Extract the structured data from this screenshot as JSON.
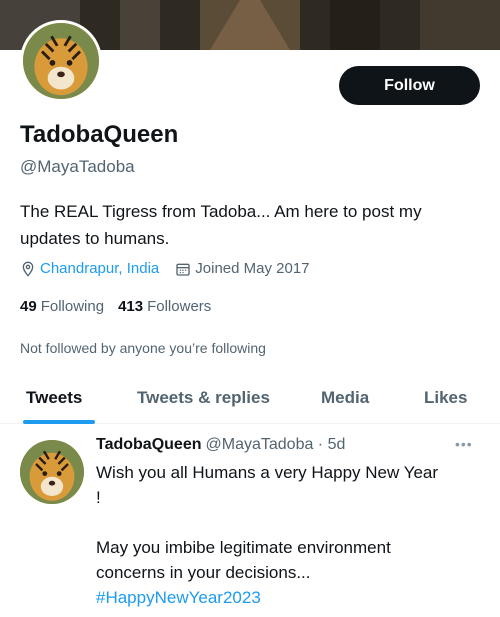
{
  "profile": {
    "display_name": "TadobaQueen",
    "handle": "@MayaTadoba",
    "bio": "The REAL Tigress from Tadoba... Am here to post my updates to humans.",
    "location": "Chandrapur, India",
    "joined": "Joined May 2017",
    "following_count": "49",
    "following_label": "Following",
    "followers_count": "413",
    "followers_label": "Followers",
    "not_followed_text": "Not followed by anyone you’re following",
    "follow_button": "Follow"
  },
  "tabs": [
    {
      "label": "Tweets",
      "active": true
    },
    {
      "label": "Tweets & replies",
      "active": false
    },
    {
      "label": "Media",
      "active": false
    },
    {
      "label": "Likes",
      "active": false
    }
  ],
  "tweet": {
    "name": "TadobaQueen",
    "handle_time": "@MayaTadoba · 5d",
    "line1": "Wish you all Humans a very Happy New Year",
    "line2": "!",
    "line3": "",
    "line4": "May you imbibe legitimate environment",
    "line5": "concerns in your decisions...",
    "hashtag": "#HappyNewYear2023",
    "more": "•••"
  },
  "colors": {
    "accent": "#1d9bf0",
    "text": "#0f1419",
    "secondary": "#536471"
  },
  "icons": {
    "location": "location-pin-icon",
    "calendar": "calendar-icon",
    "more": "more-icon"
  }
}
